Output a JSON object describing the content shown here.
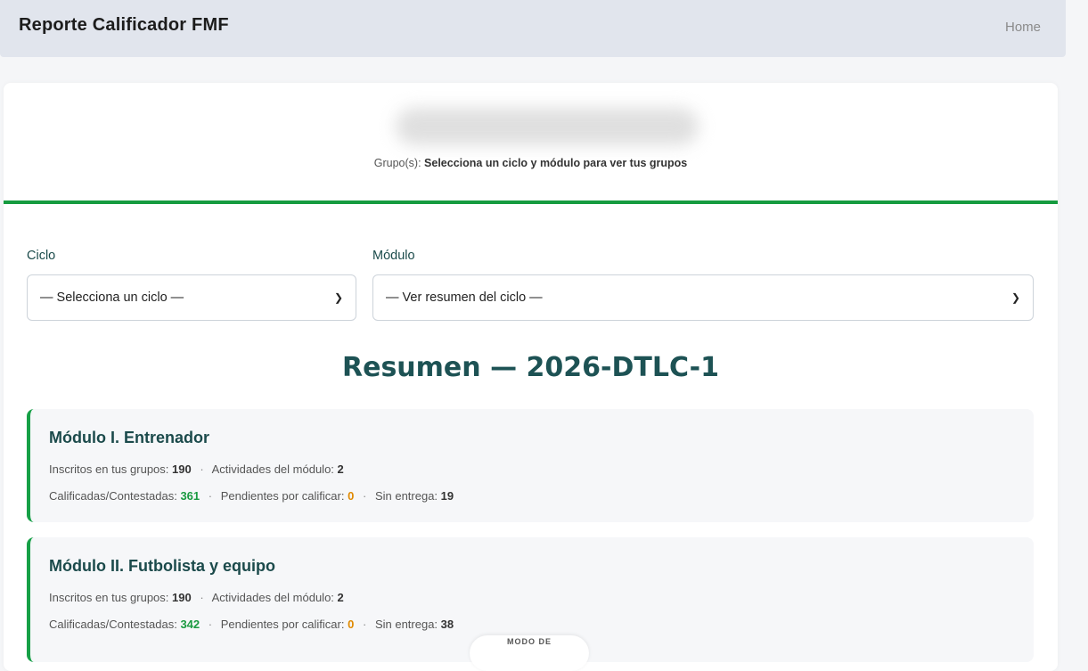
{
  "navbar": {
    "brand": "Reporte Calificador FMF",
    "home_link": "Home"
  },
  "hero": {
    "groups_label": "Grupo(s):",
    "groups_value": "Selecciona un ciclo y módulo para ver tus grupos"
  },
  "filters": {
    "ciclo_label": "Ciclo",
    "ciclo_selected": "— Selecciona un ciclo —",
    "modulo_label": "Módulo",
    "modulo_selected": "— Ver resumen del ciclo —"
  },
  "summary": {
    "title": "Resumen — 2026-DTLC-1"
  },
  "modules": [
    {
      "title": "Módulo I. Entrenador",
      "inscritos_label": "Inscritos en tus grupos:",
      "inscritos": "190",
      "actividades_label": "Actividades del módulo:",
      "actividades": "2",
      "calificadas_label": "Calificadas/Contestadas:",
      "calificadas": "361",
      "pendientes_label": "Pendientes por calificar:",
      "pendientes": "0",
      "sin_entrega_label": "Sin entrega:",
      "sin_entrega": "19"
    },
    {
      "title": "Módulo II. Futbolista y equipo",
      "inscritos_label": "Inscritos en tus grupos:",
      "inscritos": "190",
      "actividades_label": "Actividades del módulo:",
      "actividades": "2",
      "calificadas_label": "Calificadas/Contestadas:",
      "calificadas": "342",
      "pendientes_label": "Pendientes por calificar:",
      "pendientes": "0",
      "sin_entrega_label": "Sin entrega:",
      "sin_entrega": "38"
    }
  ],
  "mode_toggle": {
    "label": "MODO DE"
  },
  "colors": {
    "accent_green": "#159b3f",
    "title_teal": "#1d5254",
    "pending_orange": "#e08a00",
    "navbar_bg": "#e1e5ed"
  }
}
